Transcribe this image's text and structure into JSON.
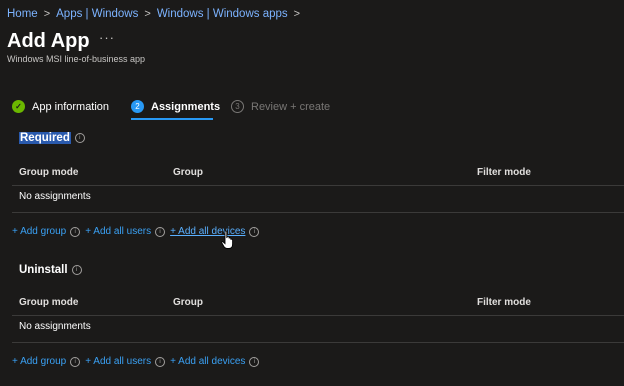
{
  "breadcrumb": {
    "items": [
      "Home",
      "Apps | Windows",
      "Windows | Windows apps"
    ],
    "separator": ">"
  },
  "page": {
    "title": "Add App",
    "more_label": "···",
    "subtitle": "Windows MSI line-of-business app"
  },
  "wizard": {
    "steps": [
      {
        "number": "✓",
        "label": "App information",
        "state": "completed"
      },
      {
        "number": "2",
        "label": "Assignments",
        "state": "active"
      },
      {
        "number": "3",
        "label": "Review + create",
        "state": "disabled"
      }
    ]
  },
  "sections": {
    "required": {
      "label": "Required",
      "columns": [
        "Group mode",
        "Group",
        "Filter mode"
      ],
      "empty_text": "No assignments",
      "actions": [
        "+ Add group",
        "+ Add all users",
        "+ Add all devices"
      ]
    },
    "uninstall": {
      "label": "Uninstall",
      "columns": [
        "Group mode",
        "Group",
        "Filter mode"
      ],
      "empty_text": "No assignments",
      "actions": [
        "+ Add group",
        "+ Add all users",
        "+ Add all devices"
      ]
    }
  },
  "colors": {
    "background": "#1b1a19",
    "link": "#3aa0f3",
    "accent": "#2899f5",
    "success": "#6bb700",
    "selection": "#2a5aad"
  },
  "icons": {
    "info": "info-circle-icon",
    "check": "checkmark-icon",
    "cursor": "hand-pointer-cursor"
  }
}
